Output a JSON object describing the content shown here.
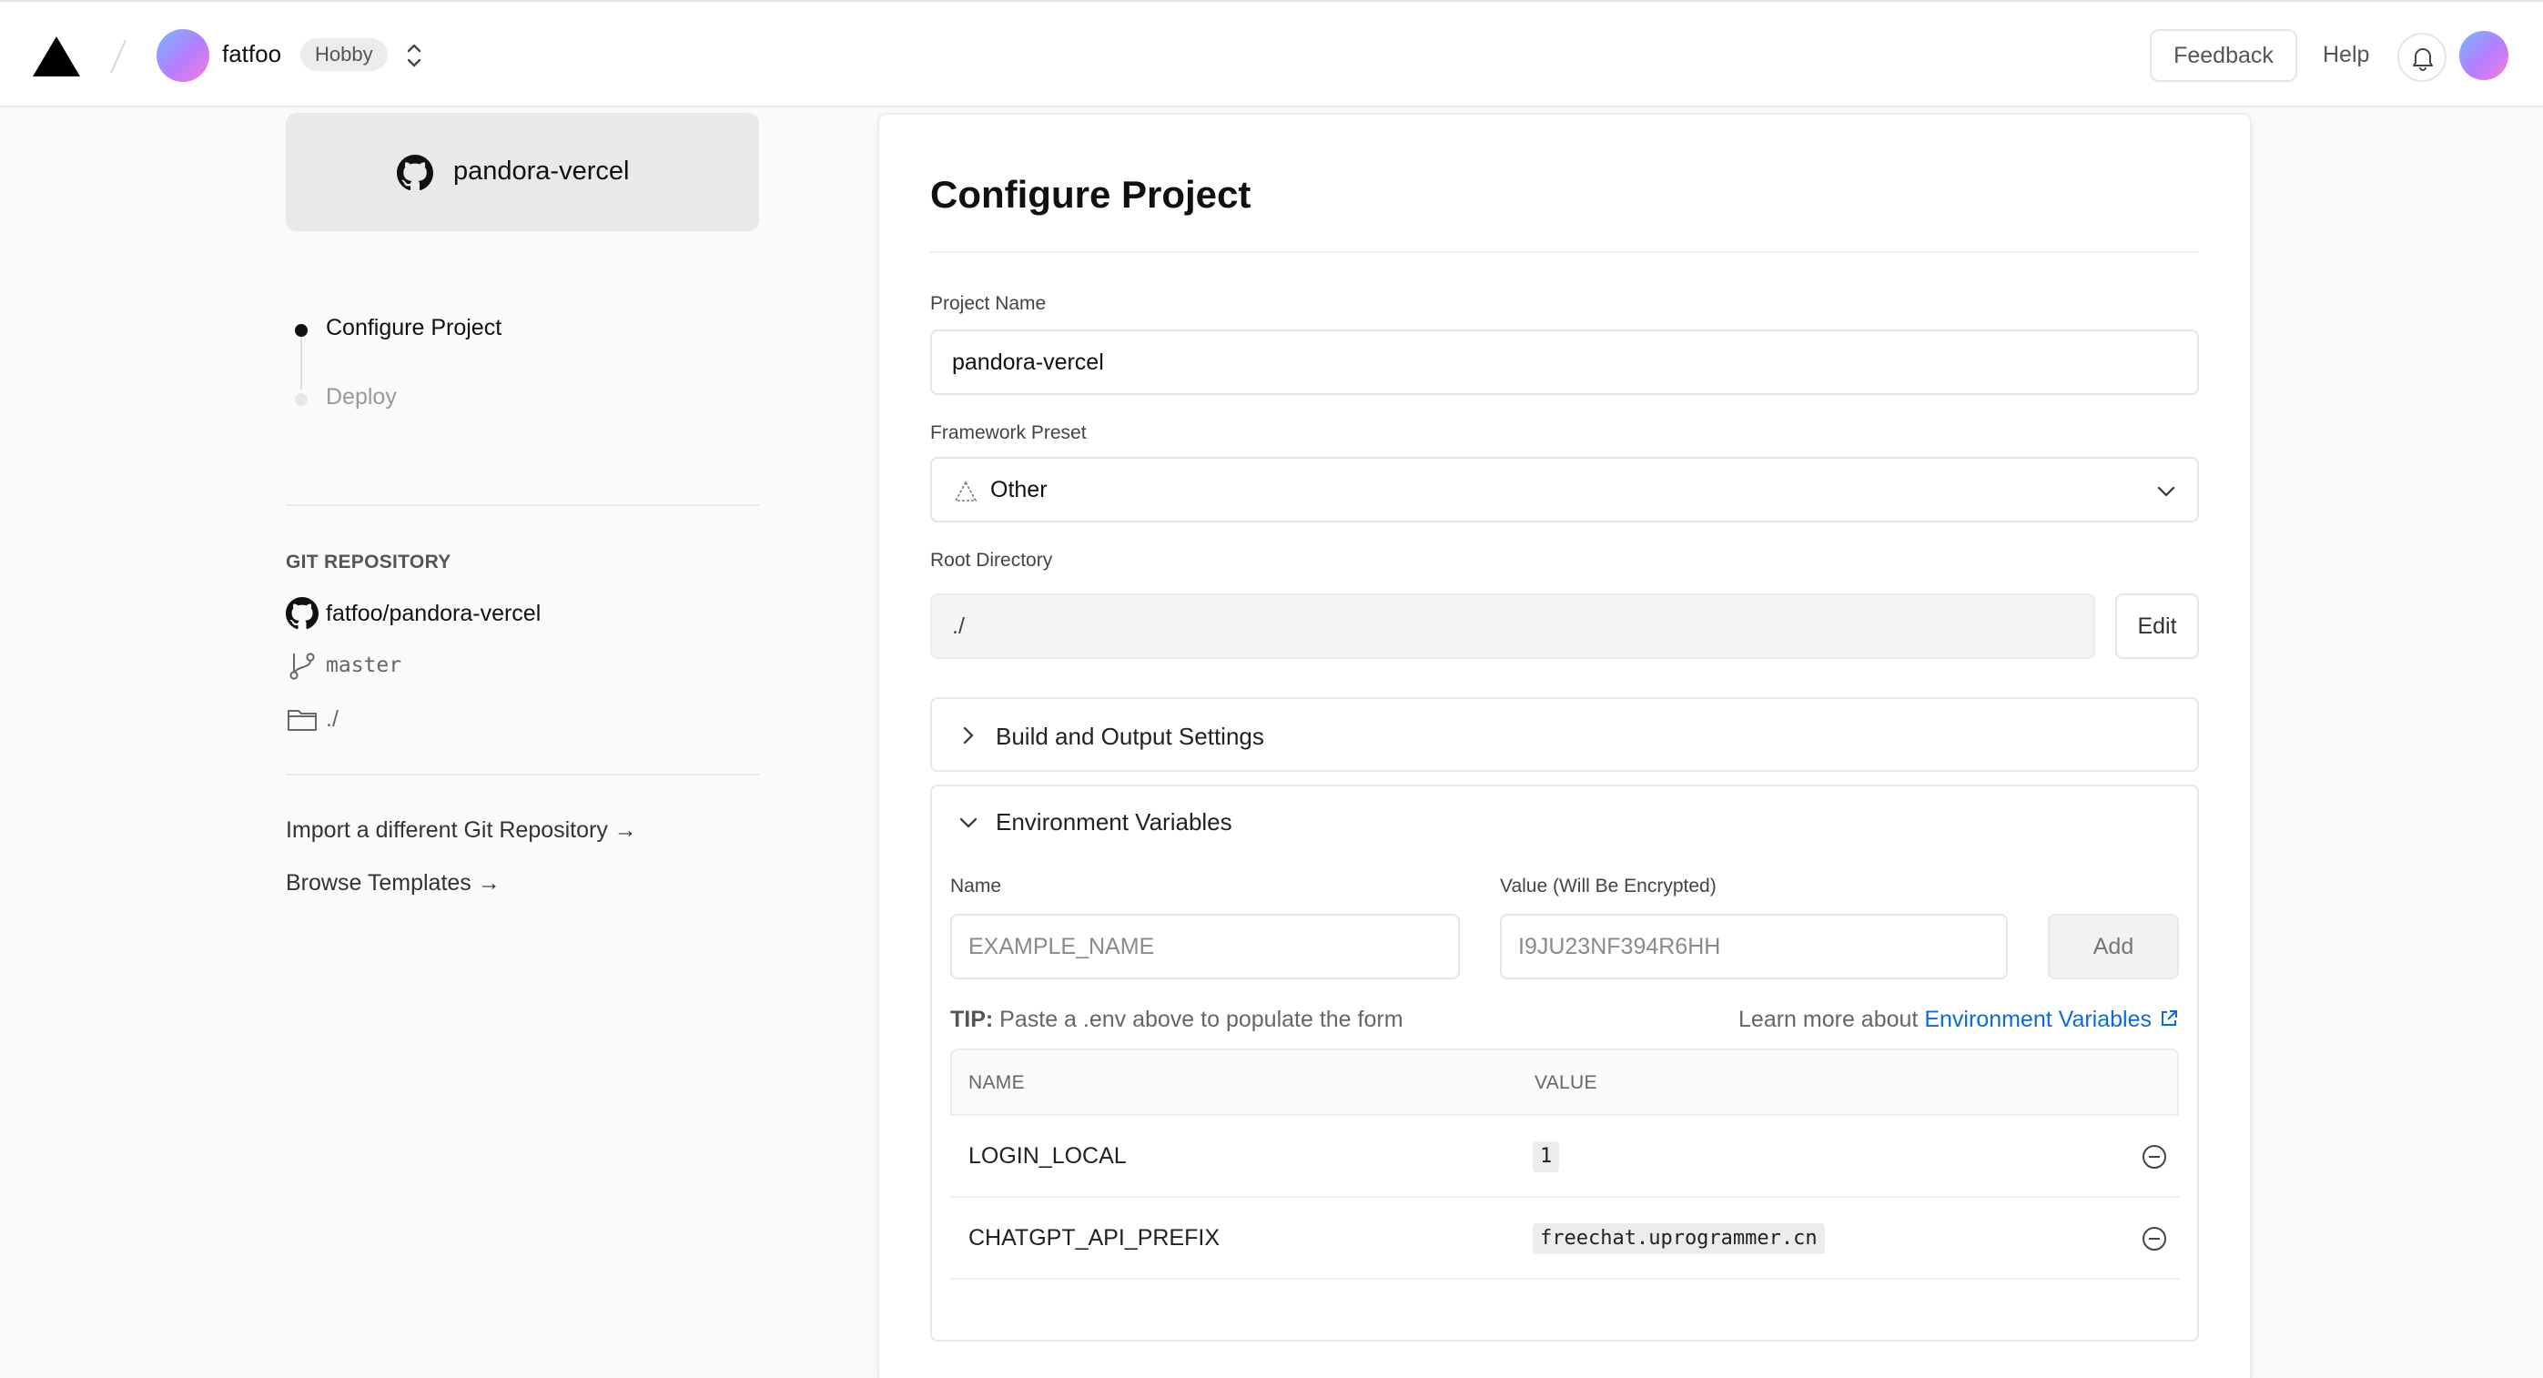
{
  "topbar": {
    "team_name": "fatfoo",
    "plan": "Hobby",
    "feedback": "Feedback",
    "help": "Help"
  },
  "left": {
    "repo_card_name": "pandora-vercel",
    "steps": [
      {
        "label": "Configure Project",
        "state": "active"
      },
      {
        "label": "Deploy",
        "state": "pending"
      }
    ],
    "git_section_title": "GIT REPOSITORY",
    "git_repo": "fatfoo/pandora-vercel",
    "git_branch": "master",
    "git_dir": "./",
    "import_link": "Import a different Git Repository →",
    "templates_link": "Browse Templates →"
  },
  "main": {
    "title": "Configure Project",
    "project_name_label": "Project Name",
    "project_name_value": "pandora-vercel",
    "framework_label": "Framework Preset",
    "framework_value": "Other",
    "root_label": "Root Directory",
    "root_value": "./",
    "edit_label": "Edit",
    "build_section": "Build and Output Settings",
    "env_section": "Environment Variables",
    "env_name_label": "Name",
    "env_value_label": "Value (Will Be Encrypted)",
    "env_name_placeholder": "EXAMPLE_NAME",
    "env_value_placeholder": "I9JU23NF394R6HH",
    "add_label": "Add",
    "tip_prefix": "TIP:",
    "tip_text": "Paste a .env above to populate the form",
    "learn_text": "Learn more about",
    "learn_link": "Environment Variables",
    "table_headers": [
      "NAME",
      "VALUE"
    ],
    "env_vars": [
      {
        "name": "LOGIN_LOCAL",
        "value": "1"
      },
      {
        "name": "CHATGPT_API_PREFIX",
        "value": "freechat.uprogrammer.cn"
      }
    ]
  },
  "colors": {
    "link": "#0b6bde",
    "avatar_gradient": [
      "#79b8ff",
      "#b57cff",
      "#ff7ad9"
    ]
  },
  "icons": [
    "vercel-logo-icon",
    "chevron-up-down-icon",
    "bell-icon",
    "github-icon",
    "git-branch-icon",
    "folder-icon",
    "triangle-outline-icon",
    "chevron-down-icon",
    "chevron-right-icon",
    "external-link-icon",
    "minus-circle-icon"
  ]
}
